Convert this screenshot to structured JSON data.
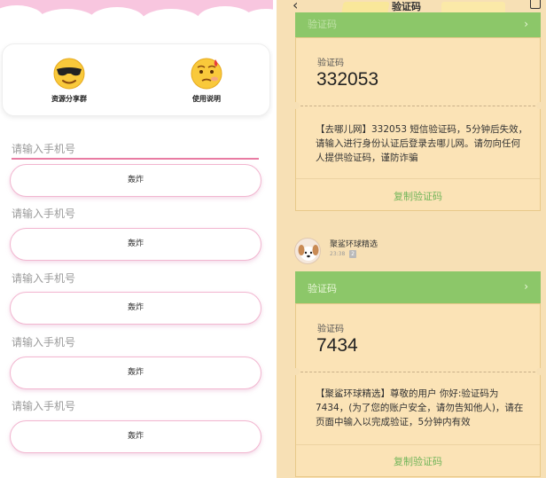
{
  "left": {
    "icons": [
      {
        "label": "资源分享群",
        "icon": "sunglasses-emoji-icon"
      },
      {
        "label": "使用说明",
        "icon": "sweat-emoji-icon"
      }
    ],
    "fields": [
      {
        "placeholder": "请输入手机号",
        "button": "轰炸"
      },
      {
        "placeholder": "请输入手机号",
        "button": "轰炸"
      },
      {
        "placeholder": "请输入手机号",
        "button": "轰炸"
      },
      {
        "placeholder": "请输入手机号",
        "button": "轰炸"
      },
      {
        "placeholder": "请输入手机号",
        "button": "轰炸"
      }
    ]
  },
  "right": {
    "header": {
      "title": "验证码"
    },
    "messages": [
      {
        "strip": "验证码",
        "label": "验证码",
        "code": "332053",
        "text": "【去哪儿网】332053 短信验证码，5分钟后失效，请输入进行身份认证后登录去哪儿网。请勿向任何人提供验证码，谨防诈骗",
        "copy": "复制验证码"
      },
      {
        "sender": "聚鲨环球精选",
        "time": "23:38",
        "badge": "2",
        "strip": "验证码",
        "label": "验证码",
        "code": "7434",
        "text": "【聚鲨环球精选】尊敬的用户 你好:验证码为7434，(为了您的账户安全，请勿告知他人)，请在页面中输入以完成验证，5分钟内有效",
        "copy": "复制验证码"
      }
    ]
  }
}
